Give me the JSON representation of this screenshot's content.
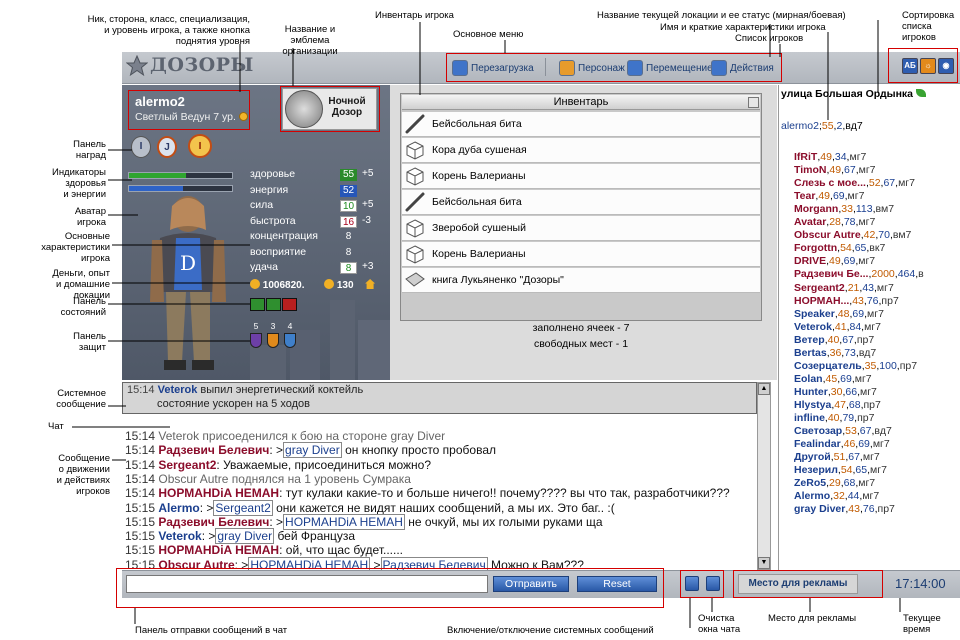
{
  "annotations": {
    "nick": "Ник, сторона, класс, специализация,\nи уровень игрока, а также кнопка\nподнятия уровня",
    "org": "Название и эмблема\nорганизации",
    "inventory": "Инвентарь игрока",
    "main_menu": "Основное меню",
    "location": "Название текущей локации и ее статус (мирная/боевая)",
    "name_stats": "Имя и краткие характеристики игрока",
    "player_list": "Список игроков",
    "sort": "Сортировка\nсписка\nигроков",
    "awards": "Панель\nнаград",
    "indicators": "Индикаторы\nздоровья\nи энергии",
    "avatar": "Аватар\nигрока",
    "main_stats": "Основные\nхарактеристики\nигрока",
    "money": "Деньги, опыт\nи домашние\nлокации",
    "states": "Панель\nсостояний",
    "protection": "Панель\nзащит",
    "system_msg": "Системное\nсообщение",
    "chat": "Чат",
    "move_msgs": "Сообщение\nо движении\nи действиях\nигроков",
    "send_panel": "Панель отправки сообщений в чат",
    "sys_toggle": "Включение/отключение системных сообщений",
    "clear_chat": "Очистка\nокна чата",
    "ad_place": "Место для рекламы",
    "current_time": "Текущее\nвремя"
  },
  "header": {
    "logo": "ДОЗОРЫ",
    "menu": [
      {
        "label": "Перезагрузка",
        "icon": "reload-icon"
      },
      {
        "label": "Персонаж",
        "icon": "character-icon"
      },
      {
        "label": "Перемещение",
        "icon": "move-icon"
      },
      {
        "label": "Действия",
        "icon": "actions-icon"
      }
    ],
    "sort_icons": [
      "АБ",
      "☼",
      "◉"
    ]
  },
  "player": {
    "name": "alermo2",
    "subtitle": "Светлый  Ведун 7 ур.",
    "org_name": "Ночной\nДозор",
    "awards": [
      "I",
      "J",
      "I"
    ],
    "health_fill": 0.55,
    "energy_fill": 0.52,
    "stats": [
      {
        "label": "здоровье",
        "value": "55",
        "bonus": "+5",
        "color": "#1e8a1e"
      },
      {
        "label": "энергия",
        "value": "52",
        "bonus": "",
        "color": "#1f4fb3"
      },
      {
        "label": "сила",
        "value": "10",
        "bonus": "+5",
        "color": "#ffffff"
      },
      {
        "label": "быстрота",
        "value": "16",
        "bonus": "-3",
        "color": "#ffffff"
      },
      {
        "label": "концентрация",
        "value": "8",
        "bonus": "",
        "color": ""
      },
      {
        "label": "восприятие",
        "value": "8",
        "bonus": "",
        "color": ""
      },
      {
        "label": "удача",
        "value": "8",
        "bonus": "+3",
        "color": "#ffffff"
      }
    ],
    "money": "1006820.",
    "exp": "130",
    "protection_levels": [
      "5",
      "3",
      "4"
    ]
  },
  "inventory": {
    "title": "Инвентарь",
    "items": [
      {
        "name": "Бейсбольная бита",
        "icon": "bat-icon"
      },
      {
        "name": "Кора дуба сушеная",
        "icon": "box-icon"
      },
      {
        "name": "Корень Валерианы",
        "icon": "box-icon"
      },
      {
        "name": "Бейсбольная бита",
        "icon": "bat-icon"
      },
      {
        "name": "Зверобой сушеный",
        "icon": "box-icon"
      },
      {
        "name": "Корень Валерианы",
        "icon": "box-icon"
      },
      {
        "name": "книга Лукьяненко \"Дозоры\"",
        "icon": "book-icon"
      }
    ],
    "filled": "заполнено ячеек - 7",
    "free": "свободных мест - 1"
  },
  "location": {
    "name": "улица Большая Ордынка",
    "me": {
      "name": "alermo2",
      "level": "55",
      "id": "2",
      "class": "вд7"
    }
  },
  "players": [
    {
      "name": "IfRiT",
      "a": "49",
      "b": "34",
      "c": "мг7",
      "color": "#8b0d2b"
    },
    {
      "name": "TimoN",
      "a": "49",
      "b": "67",
      "c": "мг7",
      "color": "#8b0d2b"
    },
    {
      "name": "Слезь с мое...",
      "a": "52",
      "b": "67",
      "c": "мг7",
      "color": "#8b0d2b"
    },
    {
      "name": "Tear",
      "a": "49",
      "b": "69",
      "c": "мг7",
      "color": "#8b0d2b"
    },
    {
      "name": "Morgann",
      "a": "33",
      "b": "113",
      "c": "вм7",
      "color": "#8b0d2b"
    },
    {
      "name": "Avatar",
      "a": "28",
      "b": "78",
      "c": "мг7",
      "color": "#8b0d2b"
    },
    {
      "name": "Obscur Autre",
      "a": "42",
      "b": "70",
      "c": "вм7",
      "color": "#8b0d2b"
    },
    {
      "name": "Forgottn",
      "a": "54",
      "b": "65",
      "c": "вк7",
      "color": "#8b0d2b"
    },
    {
      "name": "DRIVE",
      "a": "49",
      "b": "69",
      "c": "мг7",
      "color": "#8b0d2b"
    },
    {
      "name": "Радзевич Бе...",
      "a": "2000",
      "b": "464",
      "c": "в",
      "color": "#8b0d2b"
    },
    {
      "name": "Sergeant2",
      "a": "21",
      "b": "43",
      "c": "мг7",
      "color": "#8b0d2b"
    },
    {
      "name": "НОРМАН...",
      "a": "43",
      "b": "76",
      "c": "пр7",
      "color": "#8b0d2b"
    },
    {
      "name": "Speaker",
      "a": "48",
      "b": "69",
      "c": "мг7",
      "color": "#1b3f8e"
    },
    {
      "name": "Veterok",
      "a": "41",
      "b": "84",
      "c": "мг7",
      "color": "#1b3f8e"
    },
    {
      "name": "Ветер",
      "a": "40",
      "b": "67",
      "c": "пр7",
      "color": "#1b3f8e"
    },
    {
      "name": "Bertas",
      "a": "36",
      "b": "73",
      "c": "вд7",
      "color": "#1b3f8e"
    },
    {
      "name": "Созерцатель",
      "a": "35",
      "b": "100",
      "c": "пр7",
      "color": "#1b3f8e"
    },
    {
      "name": "Eolan",
      "a": "45",
      "b": "69",
      "c": "мг7",
      "color": "#1b3f8e"
    },
    {
      "name": "Hunter",
      "a": "30",
      "b": "66",
      "c": "мг7",
      "color": "#1b3f8e"
    },
    {
      "name": "Hlystya",
      "a": "47",
      "b": "68",
      "c": "пр7",
      "color": "#1b3f8e"
    },
    {
      "name": "infline",
      "a": "40",
      "b": "79",
      "c": "пр7",
      "color": "#1b3f8e"
    },
    {
      "name": "Светозар",
      "a": "53",
      "b": "67",
      "c": "вд7",
      "color": "#1b3f8e"
    },
    {
      "name": "Fealindar",
      "a": "46",
      "b": "69",
      "c": "мг7",
      "color": "#1b3f8e"
    },
    {
      "name": "Другой",
      "a": "51",
      "b": "67",
      "c": "мг7",
      "color": "#1b3f8e"
    },
    {
      "name": "Незерил",
      "a": "54",
      "b": "65",
      "c": "мг7",
      "color": "#1b3f8e"
    },
    {
      "name": "ZeRo5",
      "a": "29",
      "b": "68",
      "c": "мг7",
      "color": "#1b3f8e"
    },
    {
      "name": "Alermo",
      "a": "32",
      "b": "44",
      "c": "мг7",
      "color": "#1b3f8e"
    },
    {
      "name": "gray Diver",
      "a": "43",
      "b": "76",
      "c": "пр7",
      "color": "#1b3f8e"
    }
  ],
  "system": {
    "time": "15:14",
    "who": "Veterok",
    "text": " выпил энергетический коктейль",
    "text2": "состояние ускорен на 5 ходов"
  },
  "chat": [
    {
      "time": "15:14",
      "parts": [
        {
          "c": "gray",
          "t": "Veterok присоеденился к бою на стороне gray Diver"
        }
      ]
    },
    {
      "time": "15:14",
      "parts": [
        {
          "c": "red",
          "t": "Радзевич Белевич"
        },
        {
          "c": "",
          "t": ": >"
        },
        {
          "c": "target",
          "t": "gray Diver"
        },
        {
          "c": "",
          "t": " он кнопку просто пробовал"
        }
      ]
    },
    {
      "time": "15:14",
      "parts": [
        {
          "c": "red",
          "t": "Sergeant2"
        },
        {
          "c": "",
          "t": ": Уважаемые, присоединиться можно?"
        }
      ]
    },
    {
      "time": "15:14",
      "parts": [
        {
          "c": "gray",
          "t": "Obscur Autre поднялся на 1 уровень Сумрака"
        }
      ]
    },
    {
      "time": "15:14",
      "parts": [
        {
          "c": "red",
          "t": "НОРМАНDiA НЕМАН"
        },
        {
          "c": "",
          "t": ": тут кулаки какие-то и больше ничего!! почему???? вы что так, разработчики???"
        }
      ]
    },
    {
      "time": "15:15",
      "parts": [
        {
          "c": "blue",
          "t": "Alermo"
        },
        {
          "c": "",
          "t": ": >"
        },
        {
          "c": "target",
          "t": "Sergeant2"
        },
        {
          "c": "",
          "t": " они кажется не видят наших сообщений, а мы их. Это баг.. :("
        }
      ]
    },
    {
      "time": "15:15",
      "parts": [
        {
          "c": "red",
          "t": "Радзевич Белевич"
        },
        {
          "c": "",
          "t": ": >"
        },
        {
          "c": "target",
          "t": "НОРМАНDiA НЕМАН"
        },
        {
          "c": "",
          "t": " не очкуй, мы их голыми руками ща"
        }
      ]
    },
    {
      "time": "15:15",
      "parts": [
        {
          "c": "blue",
          "t": "Veterok"
        },
        {
          "c": "",
          "t": ": >"
        },
        {
          "c": "target",
          "t": "gray Diver"
        },
        {
          "c": "",
          "t": " бей Француза"
        }
      ]
    },
    {
      "time": "15:15",
      "parts": [
        {
          "c": "red",
          "t": "НОРМАНDiA НЕМАН"
        },
        {
          "c": "",
          "t": ": ой, что щас будет......"
        }
      ]
    },
    {
      "time": "15:15",
      "parts": [
        {
          "c": "red",
          "t": "Obscur Autre"
        },
        {
          "c": "",
          "t": ": >"
        },
        {
          "c": "target",
          "t": "НОРМАНDiA НЕМАН"
        },
        {
          "c": "",
          "t": " >"
        },
        {
          "c": "target",
          "t": "Радзевич Белевич"
        },
        {
          "c": "",
          "t": " Можно к Вам???"
        }
      ]
    }
  ],
  "bottom": {
    "input_value": "",
    "send_label": "Отправить",
    "reset_label": "Reset",
    "ad_label": "Место для рекламы",
    "time": "17:14:00"
  }
}
